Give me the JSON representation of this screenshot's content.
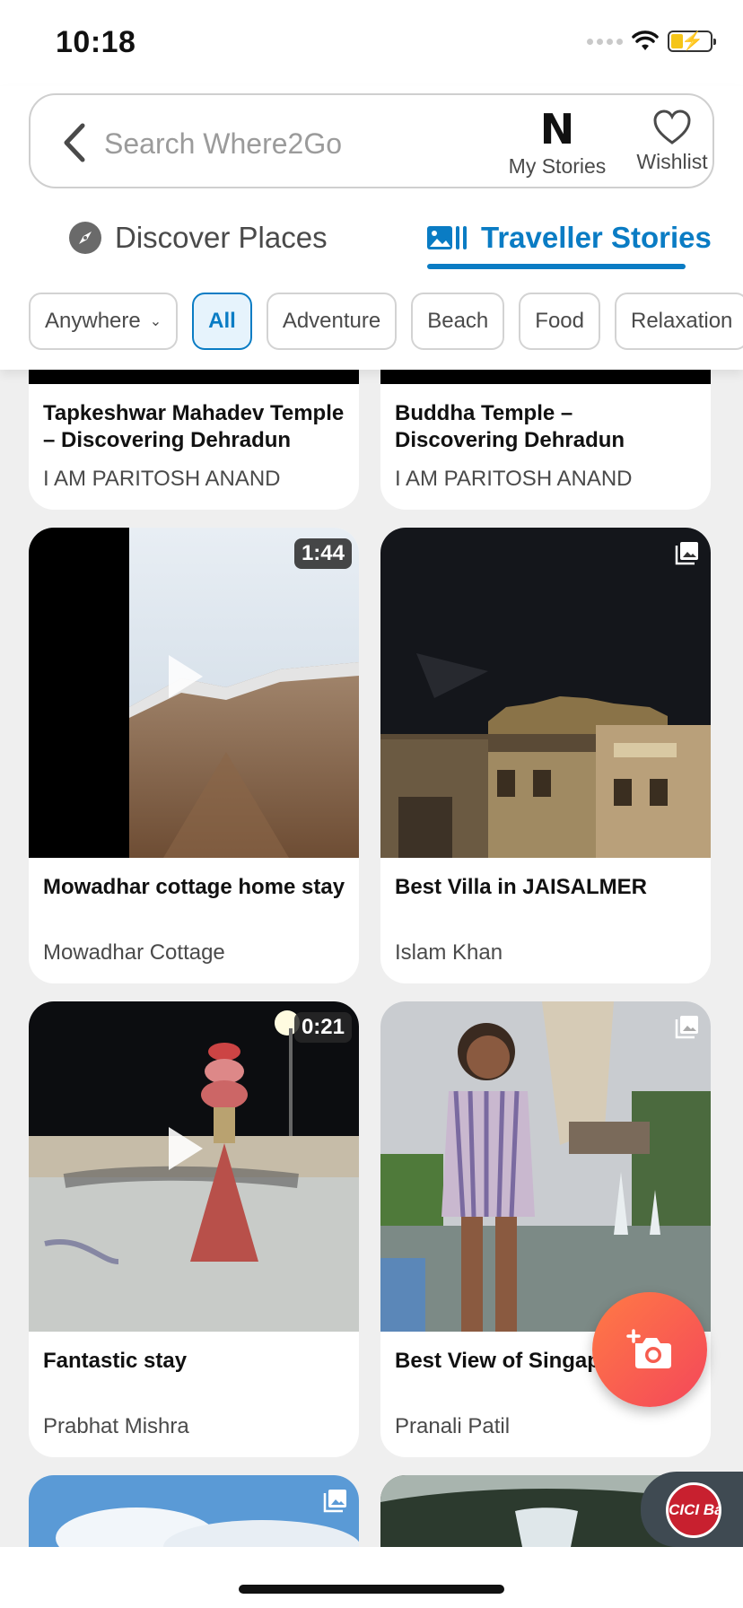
{
  "status": {
    "time": "10:18"
  },
  "header": {
    "search_placeholder": "Search Where2Go",
    "my_stories_logo": "N",
    "my_stories_label": "My Stories",
    "wishlist_label": "Wishlist"
  },
  "tabs": [
    {
      "label": "Discover Places",
      "icon": "compass-icon",
      "active": false
    },
    {
      "label": "Traveller Stories",
      "icon": "gallery-icon",
      "active": true
    }
  ],
  "filters": {
    "location": "Anywhere",
    "chips": [
      "All",
      "Adventure",
      "Beach",
      "Food",
      "Relaxation"
    ],
    "selected": "All"
  },
  "stories": [
    {
      "title": "Tapkeshwar Mahadev Temple – Discovering Dehradun",
      "author": "I AM PARITOSH ANAND"
    },
    {
      "title": "Buddha Temple – Discovering Dehradun",
      "author": "I AM PARITOSH ANAND"
    },
    {
      "title": "Mowadhar cottage home stay",
      "author": "Mowadhar Cottage",
      "media": "video",
      "duration": "1:44"
    },
    {
      "title": "Best Villa in JAISALMER",
      "author": "Islam Khan",
      "media": "gallery"
    },
    {
      "title": "Fantastic stay",
      "author": "Prabhat Mishra",
      "media": "video",
      "duration": "0:21"
    },
    {
      "title": "Best View of Singapore MMT",
      "author": "Pranali Patil",
      "media": "gallery"
    }
  ],
  "ad": {
    "label": "ICICI Ba"
  },
  "colors": {
    "accent": "#0a7cc4",
    "fab": "#f4475a"
  }
}
